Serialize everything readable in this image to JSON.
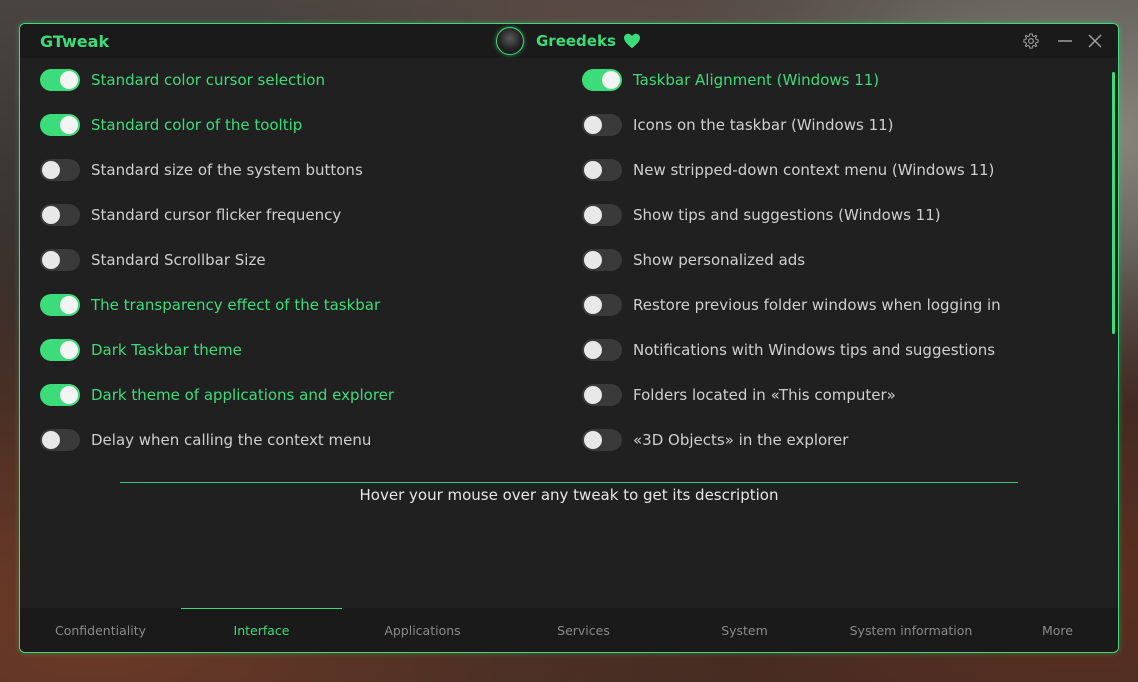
{
  "app_title": "GTweak",
  "user": {
    "name": "Greedeks"
  },
  "icons": {
    "avatar": "user-avatar",
    "heart": "heart-icon",
    "settings": "gear-icon",
    "minimize": "minimize-icon",
    "close": "close-icon"
  },
  "colors": {
    "accent": "#3ddc7a",
    "background": "#202020",
    "toggle_off": "#3a3a3a"
  },
  "left_tweaks": [
    {
      "label": "Standard color cursor selection",
      "on": true
    },
    {
      "label": "Standard color of the tooltip",
      "on": true
    },
    {
      "label": "Standard size of the system buttons",
      "on": false
    },
    {
      "label": "Standard cursor flicker frequency",
      "on": false
    },
    {
      "label": "Standard Scrollbar Size",
      "on": false
    },
    {
      "label": "The transparency effect of the taskbar",
      "on": true
    },
    {
      "label": "Dark Taskbar theme",
      "on": true
    },
    {
      "label": "Dark theme of applications and explorer",
      "on": true
    },
    {
      "label": "Delay when calling the context menu",
      "on": false
    }
  ],
  "right_tweaks": [
    {
      "label": "Taskbar Alignment (Windows 11)",
      "on": true
    },
    {
      "label": "Icons on the taskbar (Windows 11)",
      "on": false
    },
    {
      "label": "New stripped-down context menu (Windows 11)",
      "on": false
    },
    {
      "label": "Show tips and suggestions (Windows 11)",
      "on": false
    },
    {
      "label": "Show personalized ads",
      "on": false
    },
    {
      "label": "Restore previous folder windows when logging in",
      "on": false
    },
    {
      "label": "Notifications with Windows tips and suggestions",
      "on": false
    },
    {
      "label": "Folders located in «This computer»",
      "on": false
    },
    {
      "label": "«3D Objects» in the explorer",
      "on": false
    }
  ],
  "hint": "Hover your mouse over any tweak to get its description",
  "tabs": [
    {
      "label": "Confidentiality",
      "active": false
    },
    {
      "label": "Interface",
      "active": true
    },
    {
      "label": "Applications",
      "active": false
    },
    {
      "label": "Services",
      "active": false
    },
    {
      "label": "System",
      "active": false
    },
    {
      "label": "System information",
      "active": false
    },
    {
      "label": "More",
      "active": false
    }
  ]
}
